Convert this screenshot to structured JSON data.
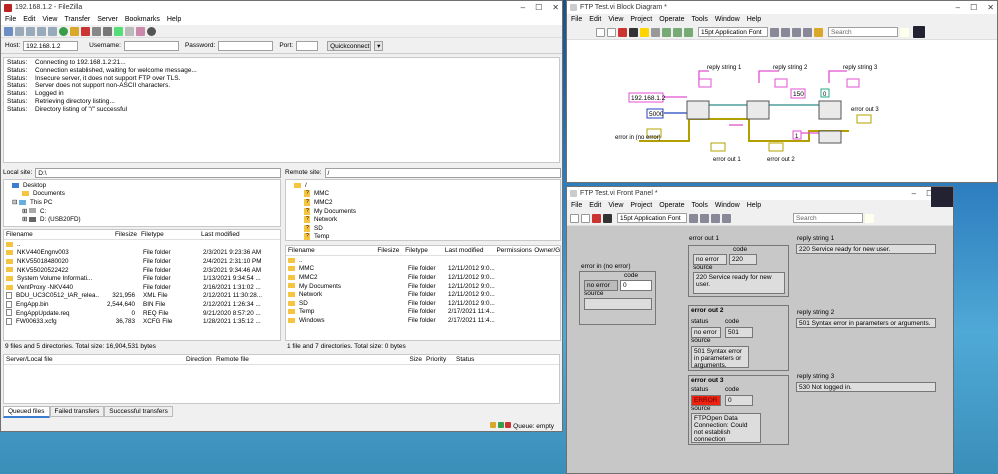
{
  "filezilla": {
    "title": "192.168.1.2 - FileZilla",
    "menu": [
      "File",
      "Edit",
      "View",
      "Transfer",
      "Server",
      "Bookmarks",
      "Help"
    ],
    "host_label": "Host:",
    "host_value": "192.168.1.2",
    "user_label": "Username:",
    "pass_label": "Password:",
    "port_label": "Port:",
    "quickconnect": "Quickconnect",
    "log": [
      [
        "Status:",
        "Connecting to 192.168.1.2:21..."
      ],
      [
        "Status:",
        "Connection established, waiting for welcome message..."
      ],
      [
        "Status:",
        "Insecure server, it does not support FTP over TLS."
      ],
      [
        "Status:",
        "Server does not support non-ASCII characters."
      ],
      [
        "Status:",
        "Logged in"
      ],
      [
        "Status:",
        "Retrieving directory listing..."
      ],
      [
        "Status:",
        "Directory listing of \"/\" successful"
      ]
    ],
    "local_site_label": "Local site:",
    "local_site_value": "D:\\",
    "remote_site_label": "Remote site:",
    "remote_site_value": "/",
    "local_tree": [
      "Desktop",
      "Documents",
      "This PC",
      "C:",
      "D: (USB20FD)"
    ],
    "remote_tree": [
      "/",
      "MMC",
      "MMC2",
      "My Documents",
      "Network",
      "SD",
      "Temp"
    ],
    "local_cols": [
      "Filename",
      "Filesize",
      "Filetype",
      "Last modified"
    ],
    "local_rows": [
      [
        "..",
        "",
        "",
        ""
      ],
      [
        "NKV440Engnv003",
        "",
        "File folder",
        "2/3/2021 9:23:36 AM"
      ],
      [
        "NKV55018480020",
        "",
        "File folder",
        "2/4/2021 2:31:10 PM"
      ],
      [
        "NKV55020522422",
        "",
        "File folder",
        "2/3/2021 9:34:46 AM"
      ],
      [
        "System Volume Informati...",
        "",
        "File folder",
        "1/13/2021 9:34:54 ..."
      ],
      [
        "VentProxy -NKV440",
        "",
        "File folder",
        "2/16/2021 1:31:02 ..."
      ],
      [
        "BDU_UC3C0512_IAR_relea...",
        "321,956",
        "XML File",
        "2/12/2021 11:30:28..."
      ],
      [
        "EngApp.bin",
        "2,544,640",
        "BIN File",
        "2/12/2021 1:26:34 ..."
      ],
      [
        "EngAppUpdate.req",
        "0",
        "REQ File",
        "9/21/2020 8:57:20 ..."
      ],
      [
        "FW00633.xcfg",
        "36,783",
        "XCFG File",
        "1/28/2021 1:35:12 ..."
      ]
    ],
    "local_status": "9 files and 5 directories. Total size: 16,904,531 bytes",
    "remote_cols": [
      "Filename",
      "Filesize",
      "Filetype",
      "Last modified",
      "Permissions",
      "Owner/G..."
    ],
    "remote_rows": [
      [
        "..",
        "",
        "",
        "",
        ""
      ],
      [
        "MMC",
        "",
        "File folder",
        "12/11/2012 9:0...",
        ""
      ],
      [
        "MMC2",
        "",
        "File folder",
        "12/11/2012 9:0...",
        ""
      ],
      [
        "My Documents",
        "",
        "File folder",
        "12/11/2012 9:0...",
        ""
      ],
      [
        "Network",
        "",
        "File folder",
        "12/11/2012 9:0...",
        ""
      ],
      [
        "SD",
        "",
        "File folder",
        "12/11/2012 9:0...",
        ""
      ],
      [
        "Temp",
        "",
        "File folder",
        "2/17/2021 11:4...",
        ""
      ],
      [
        "Windows",
        "",
        "File folder",
        "2/17/2021 11:4...",
        ""
      ]
    ],
    "remote_status": "1 file and 7 directories. Total size: 0 bytes",
    "queue_cols": [
      "Server/Local file",
      "Direction",
      "Remote file",
      "Size",
      "Priority",
      "Status"
    ],
    "queue_tabs": [
      "Queued files",
      "Failed transfers",
      "Successful transfers"
    ],
    "queue_status": "Queue: empty"
  },
  "bd": {
    "title": "FTP Test.vi Block Diagram *",
    "menu": [
      "File",
      "Edit",
      "View",
      "Project",
      "Operate",
      "Tools",
      "Window",
      "Help"
    ],
    "font": "15pt Application Font",
    "search": "Search",
    "ip": "192.168.1.2",
    "port": "5000",
    "num_150": "150",
    "const_0": "0",
    "const_1": "1",
    "labels": {
      "r1": "reply string 1",
      "r2": "reply string 2",
      "r3": "reply string 3",
      "e1": "error out 1",
      "e2": "error out 2",
      "e3": "error out 3",
      "ein": "error in (no error)"
    }
  },
  "fp": {
    "title": "FTP Test.vi Front Panel *",
    "menu": [
      "File",
      "Edit",
      "View",
      "Project",
      "Operate",
      "Tools",
      "Window",
      "Help"
    ],
    "font": "15pt Application Font",
    "search": "Search",
    "error_in": {
      "label": "error in (no error)",
      "status": "no error",
      "code_label": "code",
      "code": "0",
      "source_label": "source"
    },
    "error_out_1": {
      "label": "error out 1",
      "status": "no error",
      "code_label": "code",
      "code": "220",
      "source_label": "source",
      "source": "220 Service ready for new user."
    },
    "error_out_2": {
      "label": "error out 2",
      "status_label": "status",
      "status": "no error",
      "code_label": "code",
      "code": "501",
      "source_label": "source",
      "source": "501 Syntax error in parameters or arguments."
    },
    "error_out_3": {
      "label": "error out 3",
      "status_label": "status",
      "status": "ERROR",
      "code_label": "code",
      "code": "0",
      "source_label": "source",
      "source": "FTPOpen Data Connection: Could not establish connection"
    },
    "reply_1": {
      "label": "reply string 1",
      "value": "220 Service ready for new user."
    },
    "reply_2": {
      "label": "reply string 2",
      "value": "501 Syntax error in parameters or arguments."
    },
    "reply_3": {
      "label": "reply string 3",
      "value": "530 Not logged in."
    }
  }
}
